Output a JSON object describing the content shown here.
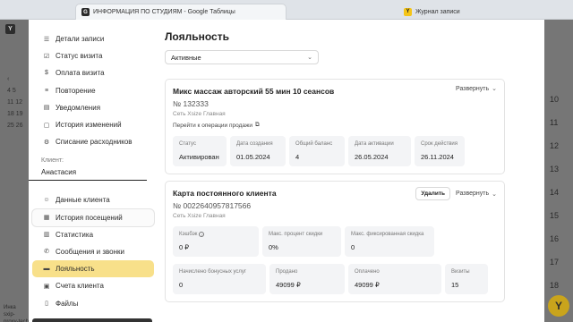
{
  "browser": {
    "tabs": [
      {
        "label": "ИНФОРМАЦИЯ ПО СТУДИЯМ - Google Таблицы",
        "icon": "sheets-icon"
      },
      {
        "label": "Журнал записи",
        "icon": "yclients-icon"
      }
    ]
  },
  "background": {
    "app_short": "XS",
    "calendar_rows": [
      "‹",
      "4  5",
      "11  12",
      "18  19",
      "25  26"
    ],
    "hours": [
      "10",
      "11",
      "12",
      "13",
      "14",
      "15",
      "16",
      "17",
      "18"
    ],
    "footer": [
      "Инка",
      "sxip-proxy-tech"
    ]
  },
  "sidebar": {
    "items_top": [
      {
        "label": "Детали записи",
        "icon": "list-icon"
      },
      {
        "label": "Статус визита",
        "icon": "check-icon"
      },
      {
        "label": "Оплата визита",
        "icon": "dollar-icon"
      },
      {
        "label": "Повторение",
        "icon": "repeat-icon"
      },
      {
        "label": "Уведомления",
        "icon": "bell-icon"
      },
      {
        "label": "История изменений",
        "icon": "history-icon"
      },
      {
        "label": "Списание расходников",
        "icon": "cart-icon"
      }
    ],
    "client_label": "Клиент:",
    "client_name": "Анастасия",
    "items_bottom": [
      {
        "label": "Данные клиента",
        "icon": "user-icon"
      },
      {
        "label": "История посещений",
        "icon": "calendar-icon"
      },
      {
        "label": "Статистика",
        "icon": "chart-icon"
      },
      {
        "label": "Сообщения и звонки",
        "icon": "phone-icon"
      },
      {
        "label": "Лояльность",
        "icon": "card-icon"
      },
      {
        "label": "Счета клиента",
        "icon": "wallet-icon"
      },
      {
        "label": "Файлы",
        "icon": "file-icon"
      }
    ]
  },
  "main": {
    "title": "Лояльность",
    "filter_value": "Активные",
    "subscription": {
      "name": "Микс массаж авторский 55 мин 10 сеансов",
      "number": "№ 132333",
      "network": "Сеть Xsize Главная",
      "link": "Перейти к операции продажи",
      "expand": "Развернуть",
      "fields": [
        {
          "label": "Статус",
          "value": "Активирован"
        },
        {
          "label": "Дата создания",
          "value": "01.05.2024"
        },
        {
          "label": "Общий баланс",
          "value": "4"
        },
        {
          "label": "Дата активации",
          "value": "26.05.2024"
        },
        {
          "label": "Срок действия",
          "value": "26.11.2024"
        }
      ]
    },
    "card": {
      "name": "Карта постоянного клиента",
      "number": "№ 0022640957817566",
      "network": "Сеть Xsize Главная",
      "delete": "Удалить",
      "expand": "Развернуть",
      "row1": [
        {
          "label": "Кэшбэк",
          "value": "0 ₽",
          "info": true
        },
        {
          "label": "Макс. процент скидки",
          "value": "0%"
        },
        {
          "label": "Макс. фиксированная скидка",
          "value": "0"
        }
      ],
      "row2": [
        {
          "label": "Начислено бонусных услуг",
          "value": "0"
        },
        {
          "label": "Продано",
          "value": "49099 ₽"
        },
        {
          "label": "Оплачено",
          "value": "49099 ₽"
        },
        {
          "label": "Визиты",
          "value": "15"
        }
      ]
    }
  }
}
